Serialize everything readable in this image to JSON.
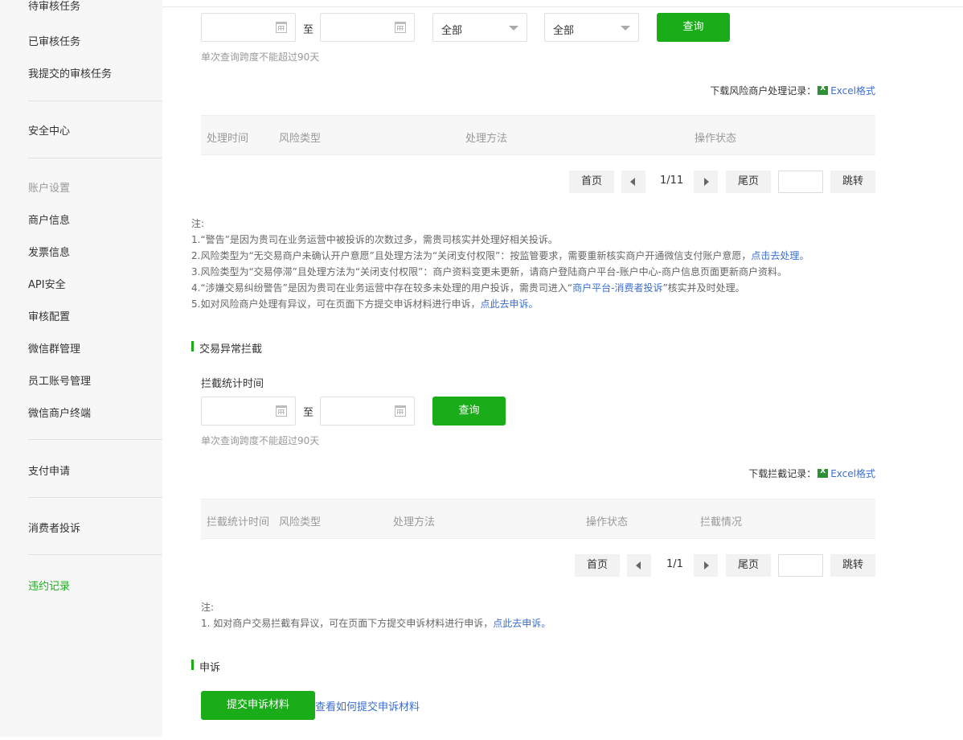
{
  "sidebar": {
    "items": [
      {
        "label": "待审核任务"
      },
      {
        "label": "已审核任务"
      },
      {
        "label": "我提交的审核任务"
      },
      {
        "label": "安全中心"
      },
      {
        "label": "账户设置"
      },
      {
        "label": "商户信息"
      },
      {
        "label": "发票信息"
      },
      {
        "label": "API安全"
      },
      {
        "label": "审核配置"
      },
      {
        "label": "微信群管理"
      },
      {
        "label": "员工账号管理"
      },
      {
        "label": "微信商户终端"
      },
      {
        "label": "支付申请"
      },
      {
        "label": "消费者投诉"
      },
      {
        "label": "违约记录"
      }
    ],
    "active_item": "违约记录",
    "active_color": "#1aad19"
  },
  "risk": {
    "date_to": "至",
    "select1": "全部",
    "select2": "全部",
    "query_label": "查询",
    "hint": "单次查询跨度不能超过90天",
    "download_prefix": "下载风险商户处理记录：",
    "download_link": "Excel格式",
    "columns": [
      "处理时间",
      "风险类型",
      "处理方法",
      "操作状态"
    ],
    "pager": {
      "first": "首页",
      "page": "1/11",
      "last": "尾页",
      "jump": "跳转"
    },
    "notes": {
      "title": "注:",
      "n1": "1.“警告”是因为贵司在业务运营中被投诉的次数过多，需贵司核实并处理好相关投诉。",
      "n2_text": "2.风险类型为“无交易商户未确认开户意愿”且处理方法为“关闭支付权限”：按监管要求，需要重新核实商户开通微信支付账户意愿，",
      "n2_link": "点击去处理。",
      "n3": "3.风险类型为“交易停滞”且处理方法为“关闭支付权限”：商户资料变更未更新，请商户登陆商户平台-账户中心-商户信息页面更新商户资料。",
      "n4_a": "4.“涉嫌交易纠纷警告”是因为贵司在业务运营中存在较多未处理的用户投诉，需贵司进入“",
      "n4_link": "商户平台-消费者投诉",
      "n4_b": "”核实并及时处理。",
      "n5_text": "5.如对风险商户处理有异议，可在页面下方提交申诉材料进行申诉，",
      "n5_link": "点此去申诉。"
    }
  },
  "intercept": {
    "title": "交易异常拦截",
    "time_label": "拦截统计时间",
    "date_to": "至",
    "query_label": "查询",
    "hint": "单次查询跨度不能超过90天",
    "download_prefix": "下载拦截记录：",
    "download_link": "Excel格式",
    "columns": [
      "拦截统计时间",
      "风险类型",
      "处理方法",
      "操作状态",
      "拦截情况"
    ],
    "pager": {
      "first": "首页",
      "page": "1/1",
      "last": "尾页",
      "jump": "跳转"
    },
    "notes": {
      "title": "注:",
      "n1_text": "1.  如对商户交易拦截有异议，可在页面下方提交申诉材料进行申诉，",
      "n1_link": "点此去申诉。"
    }
  },
  "appeal": {
    "title": "申诉",
    "submit_label": "提交申诉材料",
    "help_link": "查看如何提交申诉材料"
  },
  "colors": {
    "accent": "#1aad19",
    "link": "#3b6ed2"
  }
}
